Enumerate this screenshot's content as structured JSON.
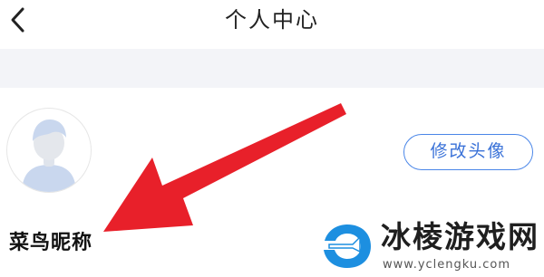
{
  "header": {
    "title": "个人中心",
    "back_icon": "chevron-left-icon"
  },
  "profile": {
    "avatar_icon": "default-avatar-icon",
    "edit_avatar_label": "修改头像",
    "nickname": "菜鸟昵称"
  },
  "annotation": {
    "arrow_color": "#e8202a"
  },
  "watermark": {
    "site_name": "冰棱游戏网",
    "url": "www.yclengku.com",
    "logo_color": "#1d8fe0"
  },
  "colors": {
    "accent": "#4a86e8",
    "band": "#f3f4f8"
  }
}
